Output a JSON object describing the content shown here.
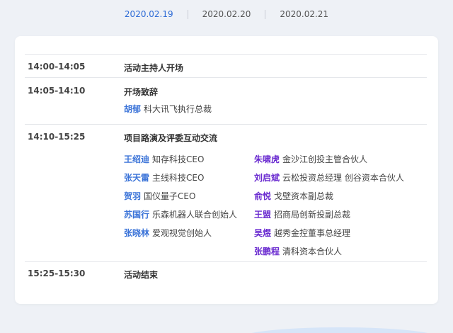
{
  "tabs": [
    {
      "label": "2020.02.19",
      "active": true
    },
    {
      "label": "2020.02.20",
      "active": false
    },
    {
      "label": "2020.02.21",
      "active": false
    }
  ],
  "schedule": [
    {
      "time": "14:00-14:05",
      "title": "活动主持人开场"
    },
    {
      "time": "14:05-14:10",
      "title": "开场致辞",
      "speakers": [
        {
          "name": "胡郁",
          "role": "科大讯飞执行总裁"
        }
      ]
    },
    {
      "time": "14:10-15:25",
      "title": "项目路演及评委互动交流",
      "presenters": [
        {
          "name": "王绍迪",
          "role": "知存科技CEO"
        },
        {
          "name": "张天雷",
          "role": "主线科技CEO"
        },
        {
          "name": "贺羽",
          "role": "国仪量子CEO"
        },
        {
          "name": "苏国行",
          "role": "乐森机器人联合创始人"
        },
        {
          "name": "张晓林",
          "role": "爱观视觉创始人"
        }
      ],
      "judges": [
        {
          "name": "朱啸虎",
          "role": "金沙江创投主管合伙人"
        },
        {
          "name": "刘启斌",
          "role": "云松投资总经理 创谷资本合伙人"
        },
        {
          "name": "俞悦",
          "role": "戈壁资本副总裁"
        },
        {
          "name": "王盟",
          "role": "招商局创新投副总裁"
        },
        {
          "name": "吴煜",
          "role": "越秀金控董事总经理"
        },
        {
          "name": "张鹏程",
          "role": "清科资本合伙人"
        }
      ]
    },
    {
      "time": "15:25-15:30",
      "title": "活动结束"
    }
  ],
  "colors": {
    "active_tab": "#2d6bd6",
    "presenter_name": "#3a73d8",
    "judge_name": "#6a2bd0"
  }
}
